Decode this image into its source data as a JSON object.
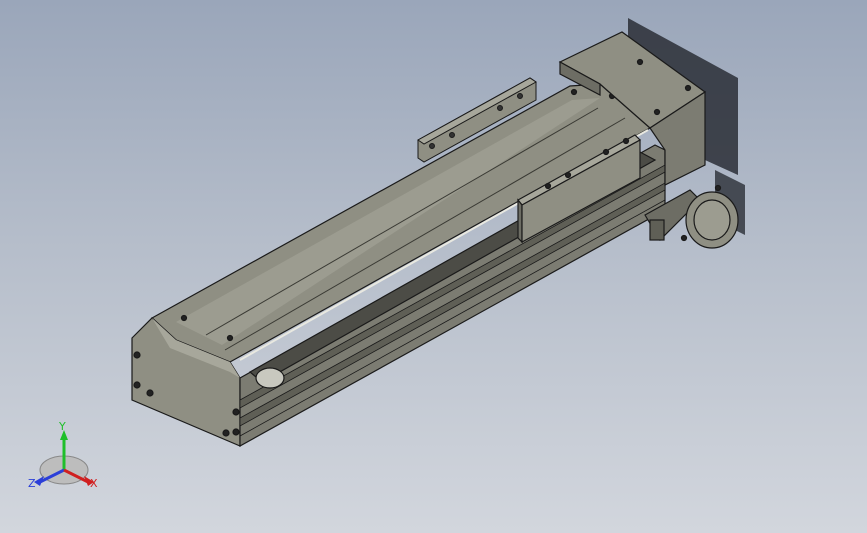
{
  "view": {
    "background_top": "#9aa6ba",
    "background_bottom": "#d2d6dd"
  },
  "model": {
    "body_color": "#8f8f83",
    "body_light": "#a7a79b",
    "body_dark": "#5f5f56",
    "edge_color": "#1a1a1a"
  },
  "triad": {
    "y_label": "Y",
    "z_label": "Z",
    "x_label": "X",
    "y_color": "#1fbf2a",
    "z_color": "#2b3fd8",
    "x_color": "#d02020"
  }
}
